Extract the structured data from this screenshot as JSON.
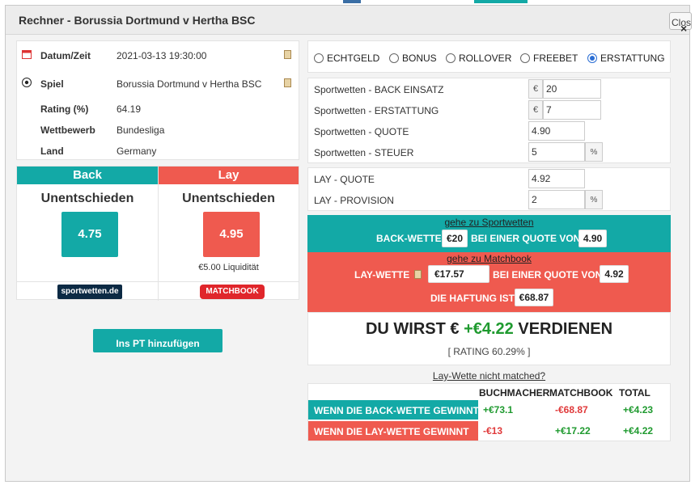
{
  "modal": {
    "title": "Rechner - Borussia Dortmund v Hertha BSC",
    "close_label": "Close"
  },
  "info": {
    "rows": [
      {
        "label": "Datum/Zeit",
        "value": "2021-03-13 19:30:00",
        "icon": "calendar-icon"
      },
      {
        "label": "Spiel",
        "value": "Borussia Dortmund v Hertha BSC",
        "icon": "soccer-ball-icon"
      },
      {
        "label": "Rating (%)",
        "value": "64.19"
      },
      {
        "label": "Wettbewerb",
        "value": "Bundesliga"
      },
      {
        "label": "Land",
        "value": "Germany"
      }
    ]
  },
  "back": {
    "header": "Back",
    "selection": "Unentschieden",
    "odds": "4.75",
    "logo": "sportwetten.de",
    "color": "#13a9a6"
  },
  "lay": {
    "header": "Lay",
    "selection": "Unentschieden",
    "odds": "4.95",
    "liquidity": "€5.00 Liquidität",
    "logo": "MATCHBOOK",
    "color": "#ef5a4f"
  },
  "pt_button": "Ins PT hinzufügen",
  "bet_types": {
    "options": [
      "ECHTGELD",
      "BONUS",
      "ROLLOVER",
      "FREEBET",
      "ERSTATTUNG"
    ],
    "selected": "ERSTATTUNG"
  },
  "sportwetten_fields": {
    "back_einsatz_label": "Sportwetten - BACK EINSATZ",
    "back_einsatz_value": "20",
    "erstattung_label": "Sportwetten - ERSTATTUNG",
    "erstattung_value": "7",
    "quote_label": "Sportwetten - QUOTE",
    "quote_value": "4.90",
    "steuer_label": "Sportwetten - STEUER",
    "steuer_value": "5",
    "currency": "€",
    "percent": "%"
  },
  "lay_fields": {
    "quote_label": "LAY - QUOTE",
    "quote_value": "4.92",
    "provision_label": "LAY - PROVISION",
    "provision_value": "2",
    "percent": "%"
  },
  "back_instruction": {
    "link": "gehe zu Sportwetten",
    "prefix": "BACK-WETTE",
    "stake": "€20",
    "middle": "BEI EINER QUOTE VON",
    "odds": "4.90"
  },
  "lay_instruction": {
    "link": "gehe zu Matchbook",
    "prefix": "LAY-WETTE",
    "stake": "€17.57",
    "middle": "BEI EINER QUOTE VON",
    "odds": "4.92",
    "liability_label": "DIE HAFTUNG IST",
    "liability": "€68.87"
  },
  "result": {
    "prefix": "DU WIRST €",
    "amount": "+€4.22",
    "suffix": "VERDIENEN",
    "rating": "[ RATING 60.29% ]"
  },
  "not_matched": "Lay-Wette nicht matched?",
  "outcome_table": {
    "headers": [
      "BUCHMACHER",
      "MATCHBOOK",
      "TOTAL"
    ],
    "rows": [
      {
        "label": "WENN DIE BACK-WETTE GEWINNT",
        "values": [
          "+€73.1",
          "-€68.87",
          "+€4.23"
        ]
      },
      {
        "label": "WENN DIE LAY-WETTE GEWINNT",
        "values": [
          "-€13",
          "+€17.22",
          "+€4.22"
        ]
      }
    ]
  }
}
